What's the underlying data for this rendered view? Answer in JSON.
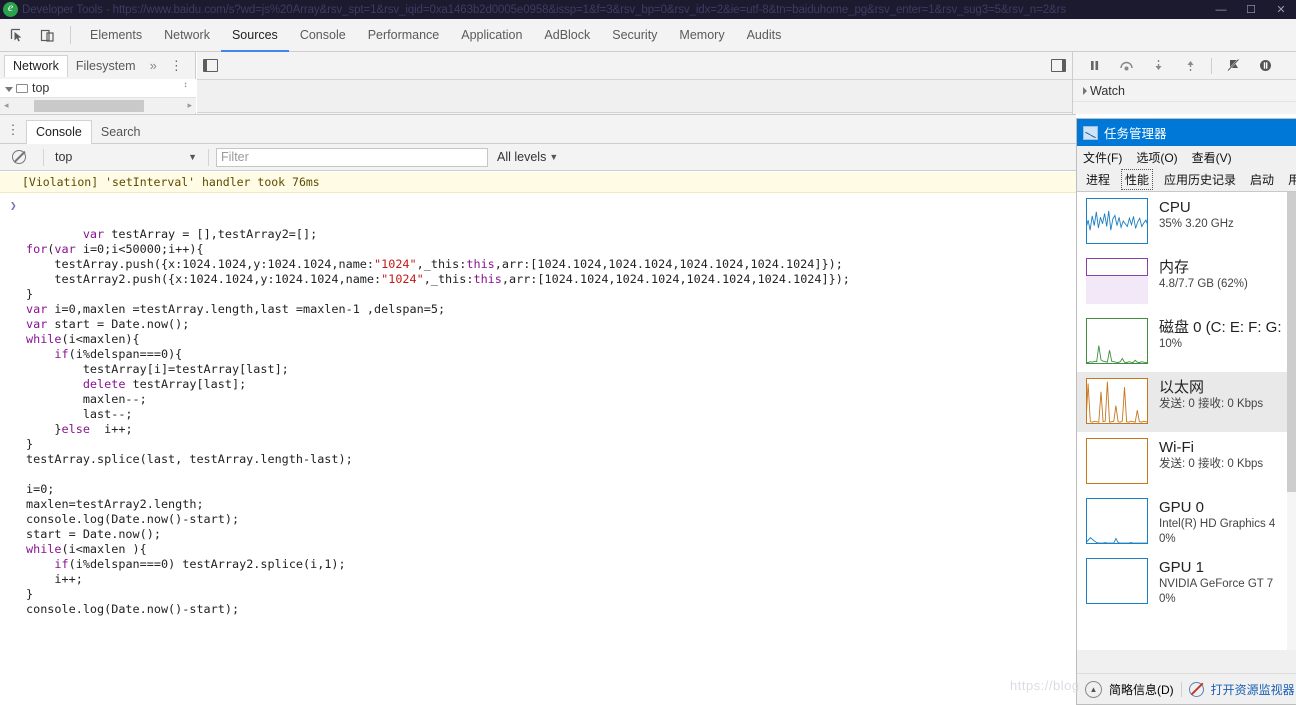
{
  "titlebar": {
    "title": "Developer Tools - https://www.baidu.com/s?wd=js%20Array&rsv_spt=1&rsv_iqid=0xa1463b2d0005e0958&issp=1&f=3&rsv_bp=0&rsv_idx=2&ie=utf-8&tn=baiduhome_pg&rsv_enter=1&rsv_sug3=5&rsv_n=2&rs",
    "minimize": "—",
    "maximize": "☐",
    "close": "✕",
    "icon": "edge-browser-icon"
  },
  "devtools": {
    "inspect_icon": "inspect-element-icon",
    "device_icon": "device-toolbar-icon",
    "tabs": [
      {
        "label": "Elements",
        "active": false
      },
      {
        "label": "Network",
        "active": false
      },
      {
        "label": "Sources",
        "active": true
      },
      {
        "label": "Console",
        "active": false
      },
      {
        "label": "Performance",
        "active": false
      },
      {
        "label": "Application",
        "active": false
      },
      {
        "label": "AdBlock",
        "active": false
      },
      {
        "label": "Security",
        "active": false
      },
      {
        "label": "Memory",
        "active": false
      },
      {
        "label": "Audits",
        "active": false
      }
    ]
  },
  "sources_sidebar": {
    "tabs": [
      {
        "label": "Network",
        "active": true
      },
      {
        "label": "Filesystem",
        "active": false
      }
    ],
    "more_label": "»",
    "menu_label": "⋮",
    "tree": [
      {
        "label": "top",
        "expanded": true
      }
    ],
    "scroll_left": "◂",
    "scroll_right": "▸",
    "spinner": "↕"
  },
  "debugger": {
    "controls": [
      {
        "name": "pause-script-execution",
        "glyph": "‖"
      },
      {
        "name": "step-over-next-function-call",
        "glyph": "⤷"
      },
      {
        "name": "step-into-next-function-call",
        "glyph": "↓"
      },
      {
        "name": "step-out-of-current-function",
        "glyph": "↑"
      },
      {
        "name": "deactivate-breakpoints",
        "glyph": "⚑"
      },
      {
        "name": "pause-on-exceptions",
        "glyph": "◐"
      }
    ],
    "watch_label": "Watch",
    "watch_expanded": false
  },
  "drawer": {
    "menu_label": "⋮",
    "tabs": [
      {
        "label": "Console",
        "active": true
      },
      {
        "label": "Search",
        "active": false
      }
    ],
    "clear_icon": "clear-console-icon",
    "context": {
      "value": "top",
      "caret": "▼"
    },
    "filter": {
      "value": "",
      "placeholder": "Filter"
    },
    "levels": {
      "label": "All levels",
      "caret": "▼"
    }
  },
  "console": {
    "violation": "[Violation] 'setInterval' handler took 76ms",
    "prompt_glyph": "❯",
    "code_lines": [
      [
        {
          "t": "kw",
          "s": "var"
        },
        {
          "t": "p",
          "s": " testArray = [],testArray2=[];"
        }
      ],
      [
        {
          "t": "kw",
          "s": "for"
        },
        {
          "t": "p",
          "s": "("
        },
        {
          "t": "kw",
          "s": "var"
        },
        {
          "t": "p",
          "s": " i=0;i<50000;i++){"
        }
      ],
      [
        {
          "t": "p",
          "s": "    testArray.push({x:1024.1024,y:1024.1024,name:"
        },
        {
          "t": "str",
          "s": "\"1024\""
        },
        {
          "t": "p",
          "s": ",_this:"
        },
        {
          "t": "kw",
          "s": "this"
        },
        {
          "t": "p",
          "s": ",arr:[1024.1024,1024.1024,1024.1024,1024.1024]});"
        }
      ],
      [
        {
          "t": "p",
          "s": "    testArray2.push({x:1024.1024,y:1024.1024,name:"
        },
        {
          "t": "str",
          "s": "\"1024\""
        },
        {
          "t": "p",
          "s": ",_this:"
        },
        {
          "t": "kw",
          "s": "this"
        },
        {
          "t": "p",
          "s": ",arr:[1024.1024,1024.1024,1024.1024,1024.1024]});"
        }
      ],
      [
        {
          "t": "p",
          "s": "}"
        }
      ],
      [
        {
          "t": "kw",
          "s": "var"
        },
        {
          "t": "p",
          "s": " i=0,maxlen =testArray.length,last =maxlen-1 ,delspan=5;"
        }
      ],
      [
        {
          "t": "kw",
          "s": "var"
        },
        {
          "t": "p",
          "s": " start = Date.now();"
        }
      ],
      [
        {
          "t": "kw",
          "s": "while"
        },
        {
          "t": "p",
          "s": "(i<maxlen){"
        }
      ],
      [
        {
          "t": "p",
          "s": "    "
        },
        {
          "t": "kw",
          "s": "if"
        },
        {
          "t": "p",
          "s": "(i%delspan===0){"
        }
      ],
      [
        {
          "t": "p",
          "s": "        testArray[i]=testArray[last];"
        }
      ],
      [
        {
          "t": "p",
          "s": "        "
        },
        {
          "t": "kw",
          "s": "delete"
        },
        {
          "t": "p",
          "s": " testArray[last];"
        }
      ],
      [
        {
          "t": "p",
          "s": "        maxlen--;"
        }
      ],
      [
        {
          "t": "p",
          "s": "        last--;"
        }
      ],
      [
        {
          "t": "p",
          "s": "    }"
        },
        {
          "t": "kw",
          "s": "else"
        },
        {
          "t": "p",
          "s": "  i++;"
        }
      ],
      [
        {
          "t": "p",
          "s": "}"
        }
      ],
      [
        {
          "t": "p",
          "s": "testArray.splice(last, testArray.length-last);"
        }
      ],
      [
        {
          "t": "p",
          "s": ""
        }
      ],
      [
        {
          "t": "p",
          "s": "i=0;"
        }
      ],
      [
        {
          "t": "p",
          "s": "maxlen=testArray2.length;"
        }
      ],
      [
        {
          "t": "p",
          "s": "console.log(Date.now()-start);"
        }
      ],
      [
        {
          "t": "p",
          "s": "start = Date.now();"
        }
      ],
      [
        {
          "t": "kw",
          "s": "while"
        },
        {
          "t": "p",
          "s": "(i<maxlen ){"
        }
      ],
      [
        {
          "t": "p",
          "s": "    "
        },
        {
          "t": "kw",
          "s": "if"
        },
        {
          "t": "p",
          "s": "(i%delspan===0) testArray2.splice(i,1);"
        }
      ],
      [
        {
          "t": "p",
          "s": "    i++;"
        }
      ],
      [
        {
          "t": "p",
          "s": "}"
        }
      ],
      [
        {
          "t": "p",
          "s": "console.log(Date.now()-start);"
        }
      ]
    ]
  },
  "taskmgr": {
    "title": "任务管理器",
    "icon": "task-manager-icon",
    "menu": [
      "文件(F)",
      "选项(O)",
      "查看(V)"
    ],
    "tabs": [
      {
        "label": "进程",
        "active": false
      },
      {
        "label": "性能",
        "active": true
      },
      {
        "label": "应用历史记录",
        "active": false
      },
      {
        "label": "启动",
        "active": false
      },
      {
        "label": "用户",
        "active": false
      }
    ],
    "items": [
      {
        "name": "CPU",
        "line1": "35% 3.20 GHz",
        "line2": "",
        "color": "#1c7fc4",
        "selected": false,
        "graph": "busy"
      },
      {
        "name": "内存",
        "line1": "4.8/7.7 GB (62%)",
        "line2": "",
        "color": "#8b3fa8",
        "selected": false,
        "graph": "memory"
      },
      {
        "name": "磁盘 0 (C: E: F: G:",
        "line1": "10%",
        "line2": "",
        "color": "#3f8f3f",
        "selected": false,
        "graph": "disk"
      },
      {
        "name": "以太网",
        "line1": "发送: 0 接收: 0 Kbps",
        "line2": "",
        "color": "#c4781c",
        "selected": true,
        "graph": "spikes"
      },
      {
        "name": "Wi-Fi",
        "line1": "发送: 0 接收: 0 Kbps",
        "line2": "",
        "color": "#c4781c",
        "selected": false,
        "graph": "flat"
      },
      {
        "name": "GPU 0",
        "line1": "Intel(R) HD Graphics 4",
        "line2": "0%",
        "color": "#1c7fc4",
        "selected": false,
        "graph": "low"
      },
      {
        "name": "GPU 1",
        "line1": "NVIDIA GeForce GT 7",
        "line2": "0%",
        "color": "#1c7fc4",
        "selected": false,
        "graph": "flat"
      }
    ],
    "footer": {
      "summary_label": "简略信息(D)",
      "summary_icon": "chevron-up-icon",
      "resource_label": "打开资源监视器",
      "resource_icon": "resource-monitor-icon"
    }
  },
  "watermark": "https://blog"
}
